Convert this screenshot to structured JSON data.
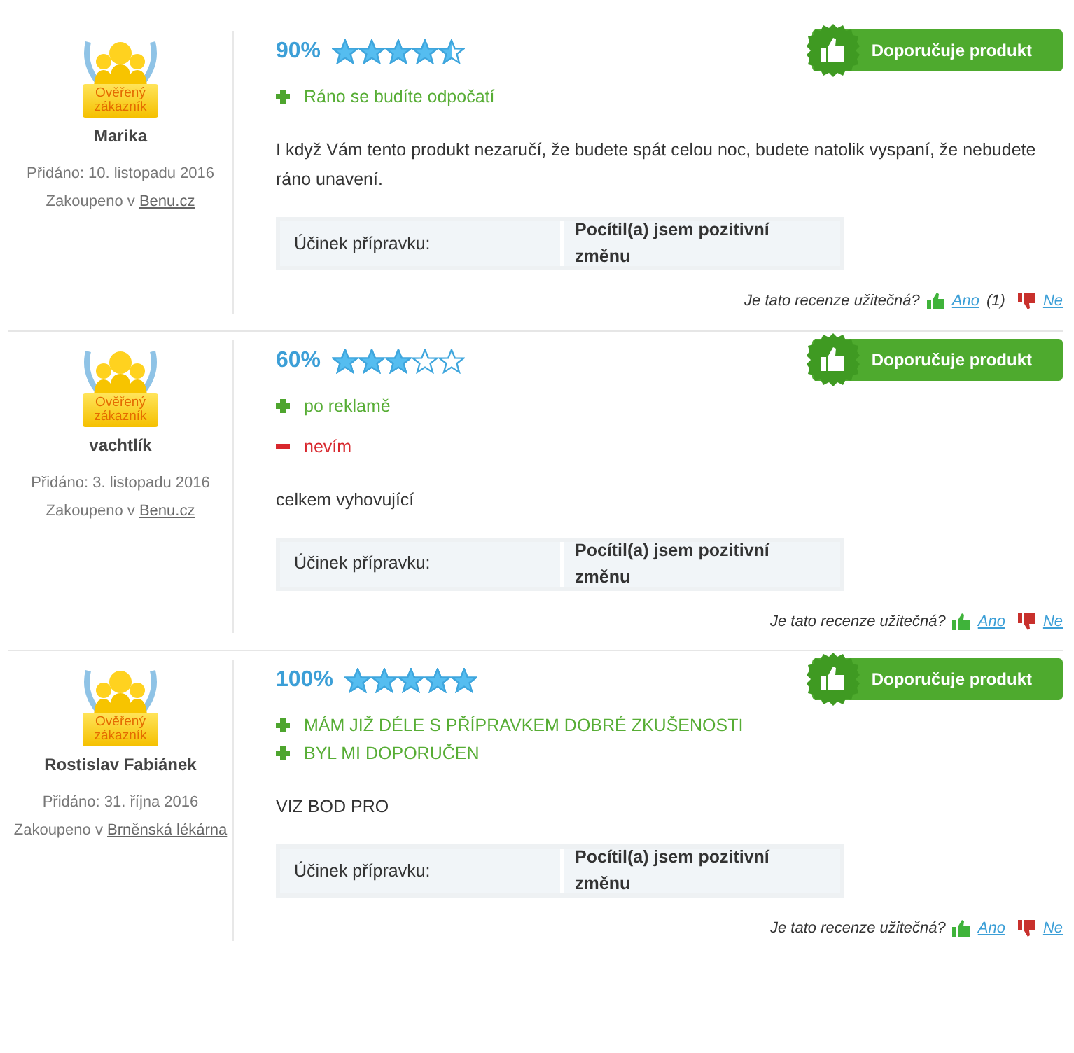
{
  "reviews": [
    {
      "badge_label": "Ověřený zákazník",
      "author": "Marika",
      "added": "Přidáno: 10. listopadu 2016",
      "bought_prefix": "Zakoupeno v",
      "shop": "Benu.cz",
      "percent": "90%",
      "stars": 4.5,
      "recommend": "Doporučuje produkt",
      "points": [
        {
          "kind": "pro",
          "text": "Ráno se budíte odpočatí"
        }
      ],
      "text": "I když Vám tento produkt nezaručí, že budete spát celou noc, budete natolik vyspaní, že nebudete ráno unavení.",
      "effect_label": "Účinek přípravku:",
      "effect_value": "Pocítil(a) jsem pozitivní změnu",
      "helpful_question": "Je tato recenze užitečná?",
      "yes": "Ano",
      "yes_count": "(1)",
      "no": "Ne"
    },
    {
      "badge_label": "Ověřený zákazník",
      "author": "vachtlík",
      "added": "Přidáno: 3. listopadu 2016",
      "bought_prefix": "Zakoupeno v",
      "shop": "Benu.cz",
      "percent": "60%",
      "stars": 3,
      "recommend": "Doporučuje produkt",
      "points": [
        {
          "kind": "pro",
          "text": "po reklamě"
        },
        {
          "kind": "con",
          "text": "nevím"
        }
      ],
      "text": "celkem vyhovující",
      "effect_label": "Účinek přípravku:",
      "effect_value": "Pocítil(a) jsem pozitivní změnu",
      "helpful_question": "Je tato recenze užitečná?",
      "yes": "Ano",
      "no": "Ne"
    },
    {
      "badge_label": "Ověřený zákazník",
      "author": "Rostislav Fabiánek",
      "added": "Přidáno: 31. října 2016",
      "bought_prefix": "Zakoupeno v",
      "shop": "Brněnská lékárna",
      "percent": "100%",
      "stars": 5,
      "recommend": "Doporučuje produkt",
      "points": [
        {
          "kind": "pro",
          "text": "MÁM JIŽ DÉLE S PŘÍPRAVKEM DOBRÉ ZKUŠENOSTI"
        },
        {
          "kind": "pro",
          "text": "BYL MI DOPORUČEN"
        }
      ],
      "text": "VIZ BOD PRO",
      "effect_label": "Účinek přípravku:",
      "effect_value": "Pocítil(a) jsem pozitivní změnu",
      "helpful_question": "Je tato recenze užitečná?",
      "yes": "Ano",
      "no": "Ne"
    }
  ]
}
